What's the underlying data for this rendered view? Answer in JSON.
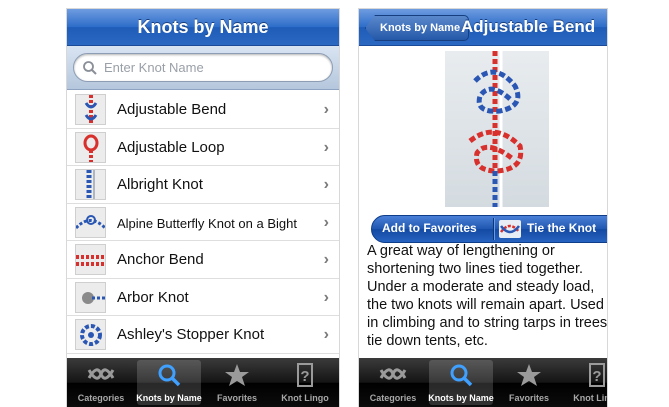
{
  "left_screen": {
    "title": "Knots by Name",
    "search": {
      "placeholder": "Enter Knot Name"
    },
    "knots": [
      {
        "name": "Adjustable Bend"
      },
      {
        "name": "Adjustable Loop"
      },
      {
        "name": "Albright Knot"
      },
      {
        "name": "Alpine Butterfly Knot on a Bight"
      },
      {
        "name": "Anchor Bend"
      },
      {
        "name": "Arbor Knot"
      },
      {
        "name": "Ashley's Stopper Knot"
      }
    ],
    "tabs": [
      {
        "label": "Categories",
        "icon": "knot-icon",
        "selected": false
      },
      {
        "label": "Knots by Name",
        "icon": "magnifier-icon",
        "selected": true
      },
      {
        "label": "Favorites",
        "icon": "star-icon",
        "selected": false
      },
      {
        "label": "Knot Lingo",
        "icon": "question-icon",
        "selected": false
      }
    ]
  },
  "right_screen": {
    "back_label": "Knots by Name",
    "title": "Adjustable Bend",
    "add_favorites_label": "Add to Favorites",
    "tie_label": "Tie the Knot",
    "description": "A great way of lengthening or shortening two lines tied together. Under a moderate and steady load, the two knots will remain apart. Used in climbing and to string tarps in trees, tie down tents, etc.",
    "tabs": [
      {
        "label": "Categories",
        "icon": "knot-icon",
        "selected": false
      },
      {
        "label": "Knots by Name",
        "icon": "magnifier-icon",
        "selected": true
      },
      {
        "label": "Favorites",
        "icon": "star-icon",
        "selected": false
      },
      {
        "label": "Knot Lingo",
        "icon": "question-icon",
        "selected": false
      }
    ]
  },
  "colors": {
    "navbar_blue": "#2d6dc9",
    "rope_red": "#d8302c",
    "rope_blue": "#2a56b4",
    "tabbar_black": "#141414"
  }
}
